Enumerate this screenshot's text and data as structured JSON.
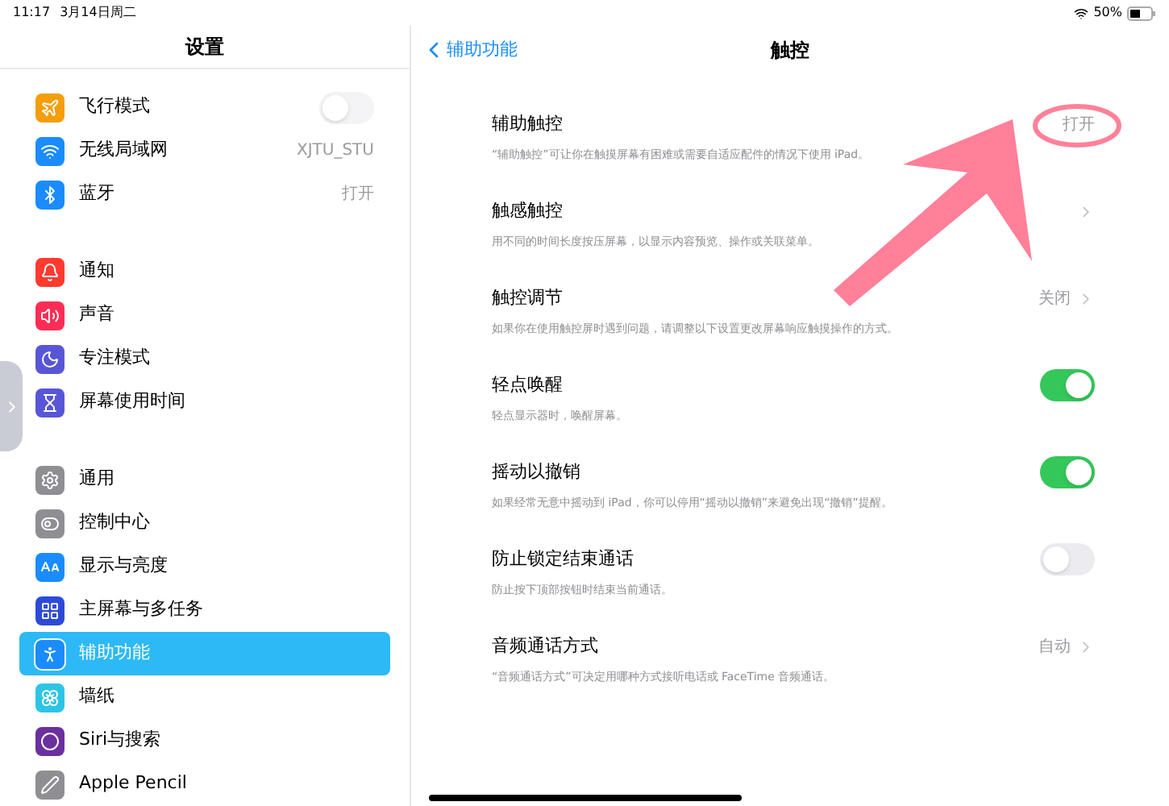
{
  "status_bar": {
    "time": "11:17",
    "date": "3月14日周二",
    "battery": "50%"
  },
  "sidebar": {
    "title": "设置",
    "groups": [
      [
        {
          "label": "飞行模式",
          "kind": "toggle",
          "on": false,
          "selected": false
        },
        {
          "label": "无线局域网",
          "kind": "value",
          "value": "XJTU_STU",
          "selected": false
        },
        {
          "label": "蓝牙",
          "kind": "value",
          "value": "打开",
          "selected": false
        }
      ],
      [
        {
          "label": "通知",
          "kind": "link",
          "selected": false
        },
        {
          "label": "声音",
          "kind": "link",
          "selected": false
        },
        {
          "label": "专注模式",
          "kind": "link",
          "selected": false
        },
        {
          "label": "屏幕使用时间",
          "kind": "link",
          "selected": false
        }
      ],
      [
        {
          "label": "通用",
          "kind": "link",
          "selected": false
        },
        {
          "label": "控制中心",
          "kind": "link",
          "selected": false
        },
        {
          "label": "显示与亮度",
          "kind": "link",
          "selected": false
        },
        {
          "label": "主屏幕与多任务",
          "kind": "link",
          "selected": false
        },
        {
          "label": "辅助功能",
          "kind": "link",
          "selected": true
        },
        {
          "label": "墙纸",
          "kind": "link",
          "selected": false
        },
        {
          "label": "Siri与搜索",
          "kind": "link",
          "selected": false
        },
        {
          "label": "Apple Pencil",
          "kind": "link",
          "selected": false
        }
      ]
    ]
  },
  "detail": {
    "back": "辅助功能",
    "title": "触控",
    "rows": [
      {
        "title": "辅助触控",
        "kind": "value",
        "value": "打开",
        "description": "“辅助触控”可让你在触摸屏幕有困难或需要自适应配件的情况下使用 iPad。"
      },
      {
        "title": "触感触控",
        "kind": "chevron",
        "chevron": true,
        "description": "用不同的时间长度按压屏幕，以显示内容预览、操作或关联菜单。"
      },
      {
        "title": "触控调节",
        "kind": "value",
        "value": "关闭",
        "chevron": true,
        "description": "如果你在使用触控屏时遇到问题，请调整以下设置更改屏幕响应触摸操作的方式。"
      },
      {
        "title": "轻点唤醒",
        "kind": "toggle",
        "on": true,
        "description": "轻点显示器时，唤醒屏幕。"
      },
      {
        "title": "摇动以撤销",
        "kind": "toggle",
        "on": true,
        "description": "如果经常无意中摇动到 iPad，你可以停用“摇动以撤销”来避免出现“撤销”提醒。"
      },
      {
        "title": "防止锁定结束通话",
        "kind": "toggle",
        "on": false,
        "description": "防止按下顶部按钮时结束当前通话。"
      },
      {
        "title": "音频通话方式",
        "kind": "value",
        "value": "自动",
        "chevron": true,
        "description": "“音频通话方式”可决定用哪种方式接听电话或 FaceTime 音频通话。"
      }
    ]
  }
}
